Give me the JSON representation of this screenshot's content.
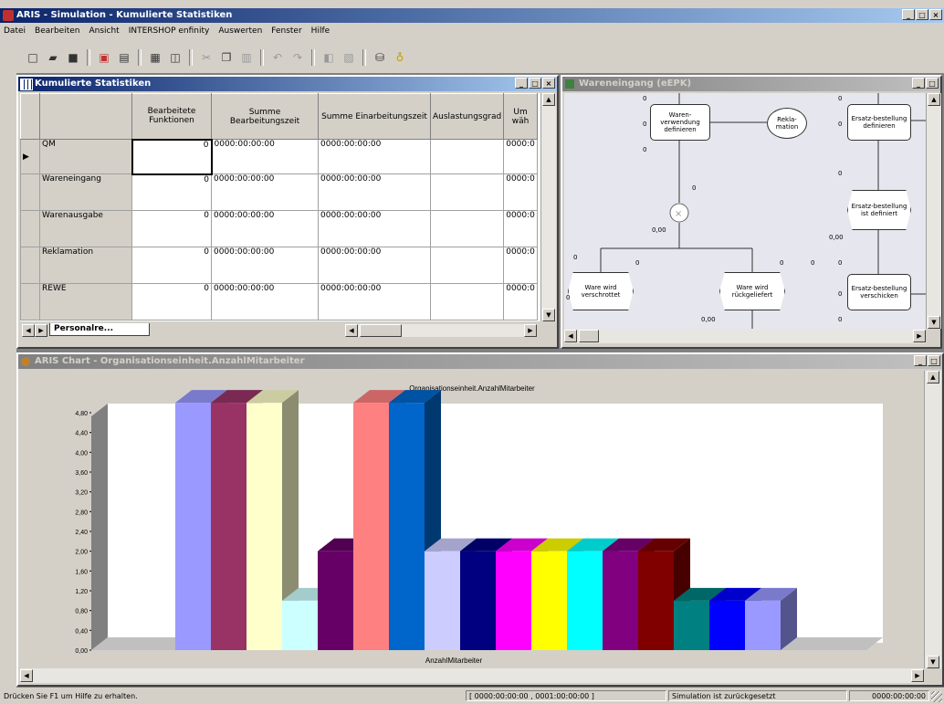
{
  "app": {
    "title": "ARIS - Simulation - Kumulierte Statistiken"
  },
  "menu": [
    {
      "label": "Datei"
    },
    {
      "label": "Bearbeiten"
    },
    {
      "label": "Ansicht"
    },
    {
      "label": "INTERSHOP enfinity"
    },
    {
      "label": "Auswerten"
    },
    {
      "label": "Fenster"
    },
    {
      "label": "Hilfe"
    }
  ],
  "stats_window": {
    "title": "Kumulierte Statistiken",
    "columns": [
      "Bearbeitete Funktionen",
      "Summe Bearbeitungszeit",
      "Summe Einarbeitungszeit",
      "Auslastungsgrad",
      "Um wäh"
    ],
    "rows": [
      {
        "name": "QM",
        "funktionen": "0",
        "bearbeitung": "0000:00:00:00",
        "einarbeitung": "0000:00:00:00",
        "auslastung": "",
        "um": "0000:0"
      },
      {
        "name": "Wareneingang",
        "funktionen": "0",
        "bearbeitung": "0000:00:00:00",
        "einarbeitung": "0000:00:00:00",
        "auslastung": "",
        "um": "0000:0"
      },
      {
        "name": "Warenausgabe",
        "funktionen": "0",
        "bearbeitung": "0000:00:00:00",
        "einarbeitung": "0000:00:00:00",
        "auslastung": "",
        "um": "0000:0"
      },
      {
        "name": "Reklamation",
        "funktionen": "0",
        "bearbeitung": "0000:00:00:00",
        "einarbeitung": "0000:00:00:00",
        "auslastung": "",
        "um": "0000:0"
      },
      {
        "name": "REWE",
        "funktionen": "0",
        "bearbeitung": "0000:00:00:00",
        "einarbeitung": "0000:00:00:00",
        "auslastung": "",
        "um": "0000:0"
      }
    ],
    "sheet_tab": "Personalre..."
  },
  "epc_window": {
    "title": "Wareneingang (eEPK)",
    "nodes": {
      "f1": "Waren-verwendung definieren",
      "e1": "Rekla-mation",
      "f2": "Ersatz-bestellung definieren",
      "ev1": "Ersatz-bestellung ist definiert",
      "ev2": "Ware wird verschrottet",
      "ev3": "Ware wird rückgeliefert",
      "f3": "Ersatz-bestellung verschicken"
    },
    "labels": {
      "zero": "0",
      "zero_dec": "0,00"
    }
  },
  "chart_window": {
    "title": "ARIS Chart - Organisationseinheit.AnzahlMitarbeiter"
  },
  "chart_data": {
    "type": "bar",
    "title": "Organisationseinheit.AnzahlMitarbeiter",
    "xlabel": "AnzahlMitarbeiter",
    "ylabel": "",
    "ylim": [
      0,
      4.8
    ],
    "yticks": [
      "0,00",
      "0,40",
      "0,80",
      "1,20",
      "1,60",
      "2,00",
      "2,40",
      "2,80",
      "3,20",
      "3,60",
      "4,00",
      "4,40",
      "4,80"
    ],
    "grid": false,
    "values": [
      5,
      5,
      5,
      1,
      2,
      5,
      5,
      2,
      2,
      2,
      2,
      2,
      2,
      2,
      1,
      1,
      1
    ],
    "colors": [
      "#9999ff",
      "#993366",
      "#ffffcc",
      "#ccffff",
      "#660066",
      "#ff8080",
      "#0066cc",
      "#ccccff",
      "#000080",
      "#ff00ff",
      "#ffff00",
      "#00ffff",
      "#800080",
      "#800000",
      "#008080",
      "#0000ff",
      "#9999ff"
    ]
  },
  "status": {
    "help": "Drücken Sie F1 um Hilfe zu erhalten.",
    "range": "[ 0000:00:00:00 , 0001:00:00:00 ]",
    "sim": "Simulation ist zurückgesetzt",
    "time": "0000:00:00:00"
  }
}
